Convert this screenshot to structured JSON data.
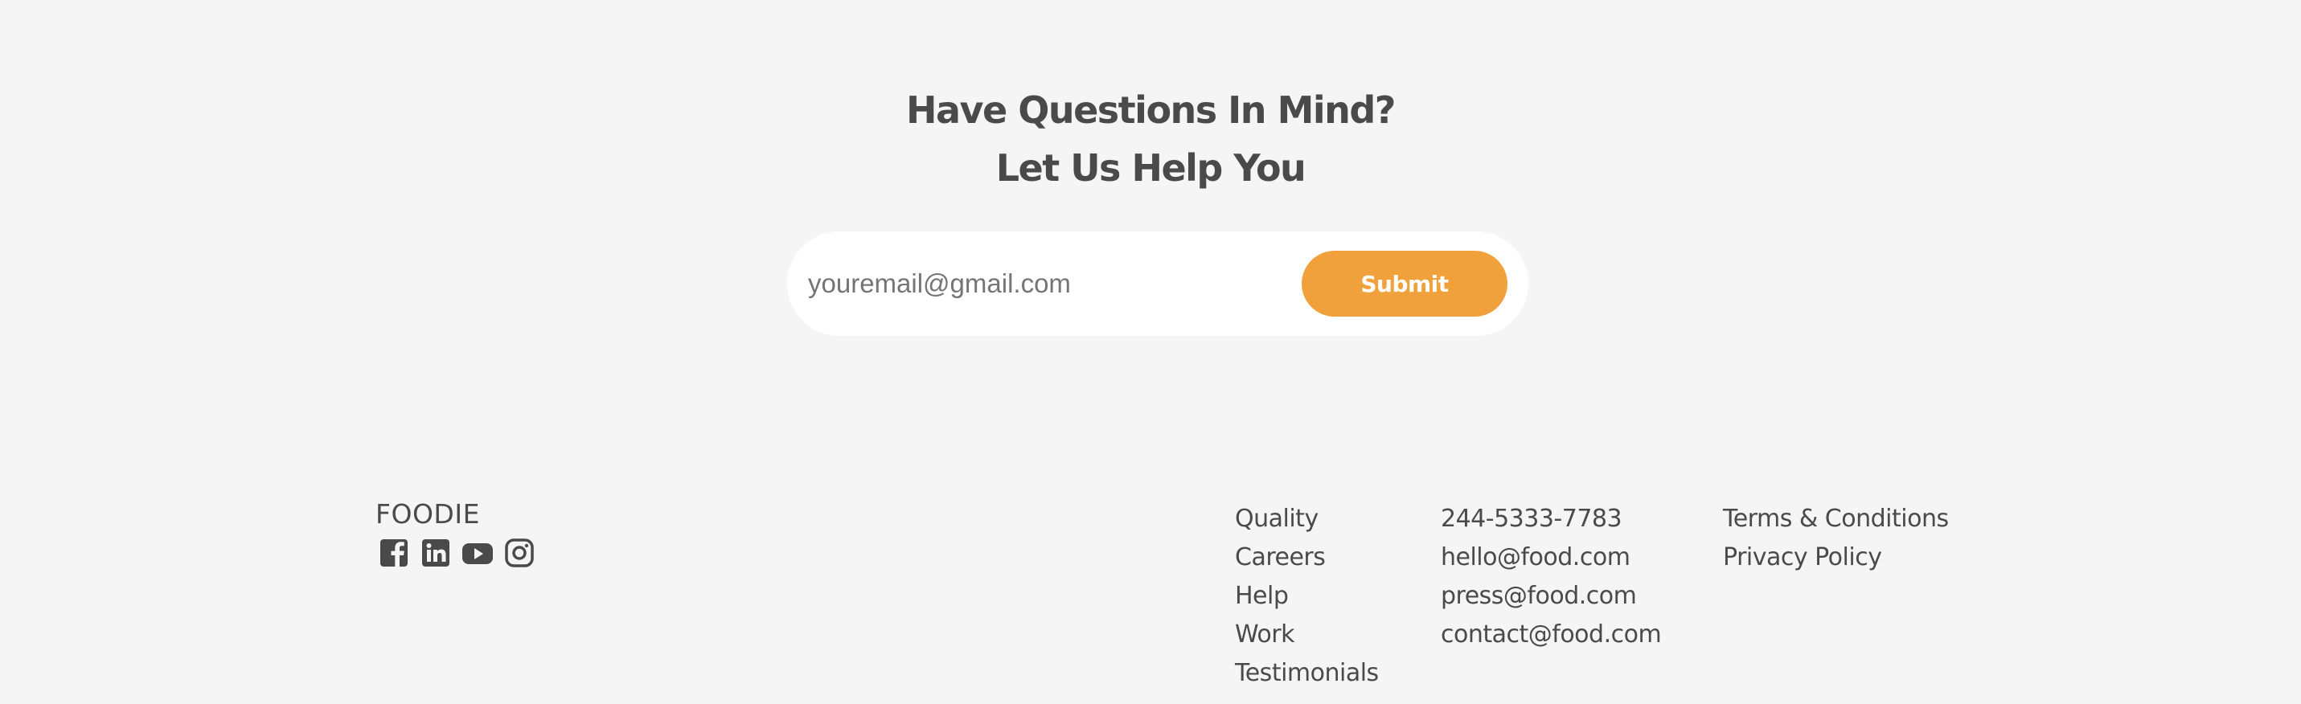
{
  "newsletter": {
    "heading_line1": "Have Questions In Mind?",
    "heading_line2": "Let Us Help You",
    "email_placeholder": "youremail@gmail.com",
    "submit_label": "Submit"
  },
  "footer": {
    "brand": "FOODIE",
    "social_icons": [
      "facebook-icon",
      "linkedin-icon",
      "youtube-icon",
      "instagram-icon"
    ],
    "links": [
      "Quality",
      "Careers",
      "Help",
      "Work",
      "Testimonials"
    ],
    "contact": [
      "244-5333-7783",
      "hello@food.com",
      "press@food.com",
      "contact@food.com"
    ],
    "legal": [
      "Terms & Conditions",
      "Privacy Policy"
    ]
  },
  "colors": {
    "background": "#f5f5f5",
    "accent": "#f0a13c",
    "text": "#4a4a4a",
    "form_background": "#ffffff"
  }
}
